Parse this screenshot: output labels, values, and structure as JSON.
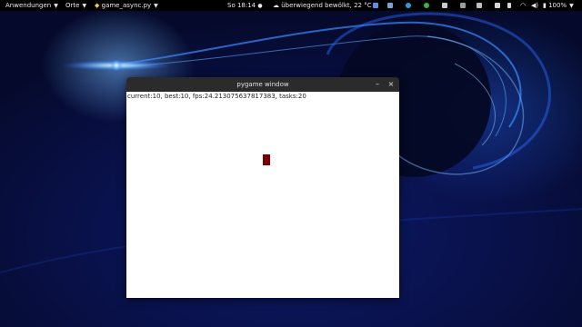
{
  "topbar": {
    "applications_label": "Anwendungen",
    "places_label": "Orte",
    "app_name": "game_async.py",
    "clock": "So 18:14",
    "weather": "überwiegend bewölkt, 22 °C",
    "battery": "100%",
    "tray_icons": [
      "bluetooth-icon",
      "sync-icon",
      "network-icon",
      "check-icon",
      "clipboard-icon",
      "power-icon",
      "display-icon",
      "screen-icon",
      "clipboard-indicator-icon",
      "settings-icon",
      "wifi-icon",
      "volume-icon",
      "battery-icon"
    ]
  },
  "window": {
    "title": "pygame window",
    "minimize_label": "–",
    "close_label": "×",
    "status_text": "current:10,   best:10,   fps:24.213075637817383,   tasks:20",
    "player_color": "#7a0000"
  },
  "colors": {
    "topbar_bg": "#000000",
    "titlebar_bg": "#2b2b2b",
    "canvas_bg": "#ffffff",
    "desktop_base": "#09114a"
  }
}
